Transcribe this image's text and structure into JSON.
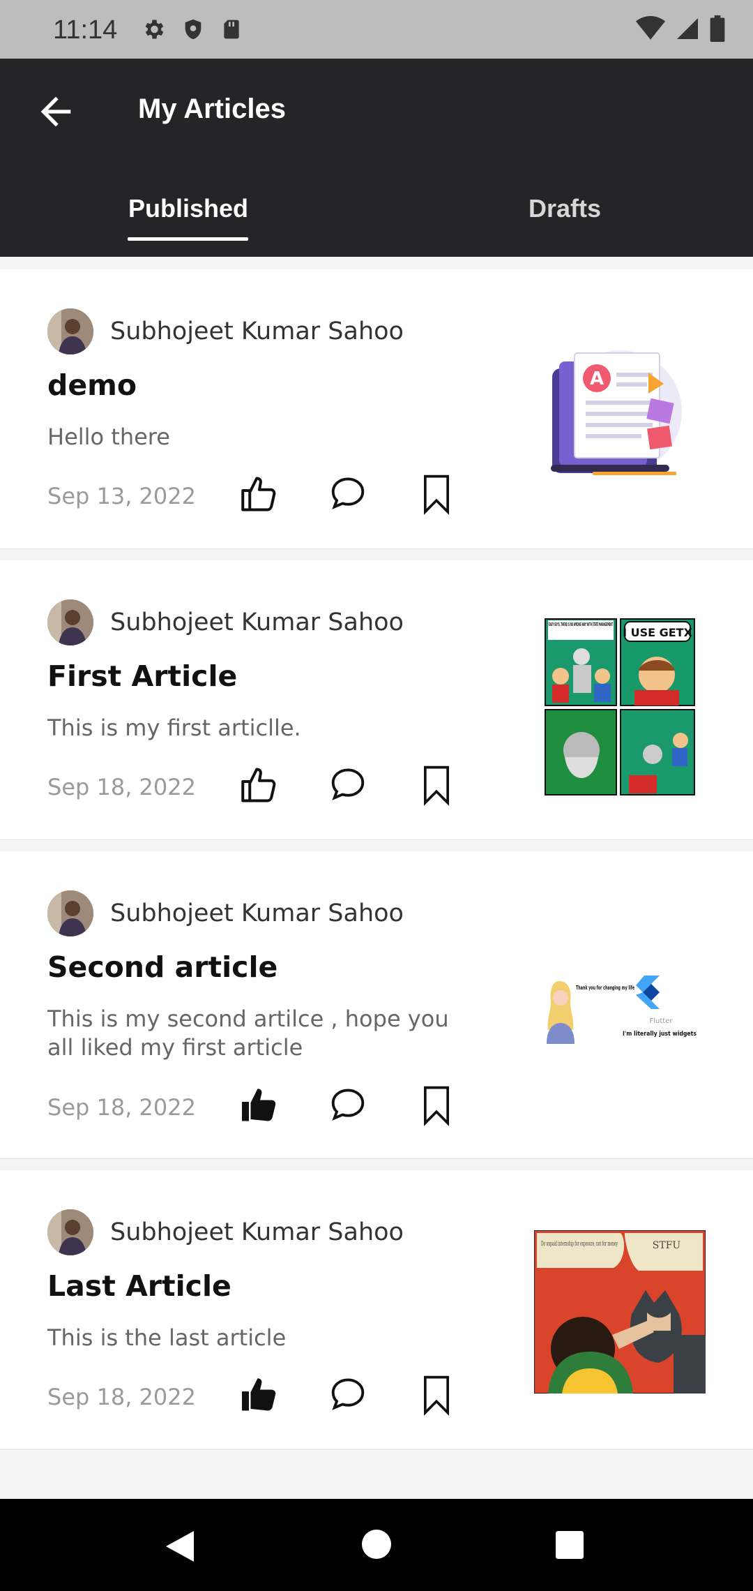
{
  "status_bar": {
    "time": "11:14",
    "left_icons": [
      "settings-icon",
      "shield-icon",
      "sd-card-icon"
    ],
    "right_icons": [
      "wifi-icon",
      "signal-icon",
      "battery-icon"
    ]
  },
  "app_bar": {
    "title": "My Articles",
    "back_icon": "arrow-left-icon"
  },
  "tabs": [
    {
      "label": "Published",
      "active": true
    },
    {
      "label": "Drafts",
      "active": false
    }
  ],
  "articles": [
    {
      "author": "Subhojeet Kumar Sahoo",
      "title": "demo",
      "body": "Hello there",
      "date": "Sep 13, 2022",
      "liked": false,
      "thumbnail": "document-illustration"
    },
    {
      "author": "Subhojeet Kumar Sahoo",
      "title": "First Article",
      "body": "This is my first articlle.",
      "date": "Sep 18, 2022",
      "liked": false,
      "thumbnail": "getx-comic-meme",
      "thumbnail_text": [
        "EASY GUYS, THERE IS NO WRONG WAY WITH STATE MANAGEMENT",
        "I USE GETX"
      ]
    },
    {
      "author": "Subhojeet Kumar Sahoo",
      "title": "Second article",
      "body": "This is my second artilce , hope you all liked my first article",
      "date": "Sep 18, 2022",
      "liked": true,
      "thumbnail": "flutter-widgets-meme",
      "thumbnail_text": [
        "Thank you for changing my life",
        "Flutter",
        "I'm literally just widgets"
      ]
    },
    {
      "author": "Subhojeet Kumar Sahoo",
      "title": "Last Article",
      "body": "This is the last article",
      "date": "Sep 18, 2022",
      "liked": true,
      "thumbnail": "batman-slap-meme",
      "thumbnail_text": [
        "Do unpaid internship for exposure, not for money",
        "STFU"
      ]
    }
  ],
  "nav_bar": {
    "icons": [
      "back-triangle-icon",
      "home-circle-icon",
      "recents-square-icon"
    ]
  },
  "colors": {
    "app_bar": "#252528",
    "status_bar": "#bdbdbd",
    "card": "#ffffff",
    "background": "#f5f5f5"
  }
}
